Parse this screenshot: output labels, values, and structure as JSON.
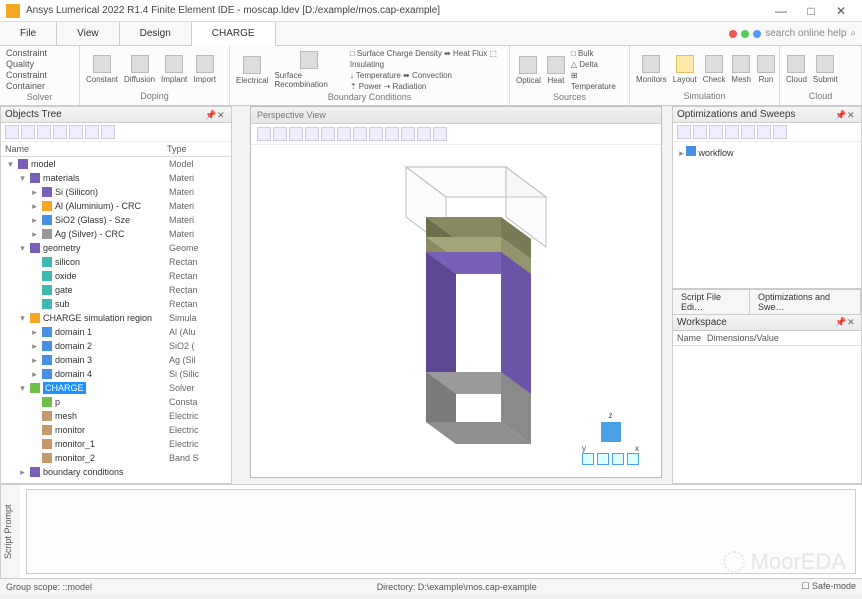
{
  "window": {
    "title": "Ansys Lumerical 2022 R1.4 Finite Element IDE - moscap.ldev [D:/example/mos.cap-example]",
    "min": "—",
    "max": "□",
    "close": "✕"
  },
  "menu": {
    "file": "File",
    "view": "View",
    "design": "Design",
    "charge": "CHARGE",
    "search_placeholder": "search online help",
    "search_sym": "⌕"
  },
  "ribbon": {
    "solver": {
      "label": "Solver",
      "constraint": "Constraint",
      "quality_constraint": "Quality Constraint",
      "container": "Container"
    },
    "doping": {
      "label": "Doping",
      "constant": "Constant",
      "diffusion": "Diffusion",
      "implant": "Implant",
      "import": "Import"
    },
    "boundary": {
      "label": "Boundary Conditions",
      "electrical": "Electrical",
      "surface_recomb": "Surface Recombination",
      "l1": "□ Surface Charge Density  ⬌ Heat Flux  ⬚ Insulating",
      "l2": "↓ Temperature            ⬌ Convection",
      "l3": "⇡ Power                  ⇢ Radiation"
    },
    "sources": {
      "label": "Sources",
      "optical": "Optical",
      "heat": "Heat",
      "bulk": "□ Bulk",
      "delta": "△ Delta",
      "temperature": "⊞ Temperature"
    },
    "simulation": {
      "label": "Simulation",
      "monitors": "Monitors",
      "layout": "Layout",
      "check": "Check",
      "mesh": "Mesh",
      "run": "Run"
    },
    "cloud": {
      "label": "Cloud",
      "cloud": "Cloud",
      "submit": "Submit"
    }
  },
  "objtree": {
    "title": "Objects Tree",
    "col1": "Name",
    "col2": "Type",
    "rows": [
      {
        "d": 0,
        "tw": "▾",
        "i": "purple",
        "n": "model",
        "t": "Model"
      },
      {
        "d": 1,
        "tw": "▾",
        "i": "purple",
        "n": "materials",
        "t": "Materi"
      },
      {
        "d": 2,
        "tw": "▸",
        "i": "purple",
        "n": "Si (Silicon)",
        "t": "Materi"
      },
      {
        "d": 2,
        "tw": "▸",
        "i": "orange",
        "n": "Al (Aluminium) - CRC",
        "t": "Materi"
      },
      {
        "d": 2,
        "tw": "▸",
        "i": "blue",
        "n": "SiO2 (Glass) - Sze",
        "t": "Materi"
      },
      {
        "d": 2,
        "tw": "▸",
        "i": "gray",
        "n": "Ag (Silver) - CRC",
        "t": "Materi"
      },
      {
        "d": 1,
        "tw": "▾",
        "i": "purple",
        "n": "geometry",
        "t": "Geome"
      },
      {
        "d": 2,
        "tw": "",
        "i": "teal",
        "n": "silicon",
        "t": "Rectan"
      },
      {
        "d": 2,
        "tw": "",
        "i": "teal",
        "n": "oxide",
        "t": "Rectan"
      },
      {
        "d": 2,
        "tw": "",
        "i": "teal",
        "n": "gate",
        "t": "Rectan"
      },
      {
        "d": 2,
        "tw": "",
        "i": "teal",
        "n": "sub",
        "t": "Rectan"
      },
      {
        "d": 1,
        "tw": "▾",
        "i": "orange",
        "n": "CHARGE simulation region",
        "t": "Simula"
      },
      {
        "d": 2,
        "tw": "▸",
        "i": "blue",
        "n": "domain 1",
        "t": "Al (Alu"
      },
      {
        "d": 2,
        "tw": "▸",
        "i": "blue",
        "n": "domain 2",
        "t": "SiO2 ("
      },
      {
        "d": 2,
        "tw": "▸",
        "i": "blue",
        "n": "domain 3",
        "t": "Ag (Sil"
      },
      {
        "d": 2,
        "tw": "▸",
        "i": "blue",
        "n": "domain 4",
        "t": "Si (Silic"
      },
      {
        "d": 1,
        "tw": "▾",
        "i": "green",
        "n": "CHARGE",
        "t": "Solver",
        "sel": true
      },
      {
        "d": 2,
        "tw": "",
        "i": "green",
        "n": "p",
        "t": "Consta"
      },
      {
        "d": 2,
        "tw": "",
        "i": "brown",
        "n": "mesh",
        "t": "Electric"
      },
      {
        "d": 2,
        "tw": "",
        "i": "brown",
        "n": "monitor",
        "t": "Electric"
      },
      {
        "d": 2,
        "tw": "",
        "i": "brown",
        "n": "monitor_1",
        "t": "Electric"
      },
      {
        "d": 2,
        "tw": "",
        "i": "brown",
        "n": "monitor_2",
        "t": "Band S"
      },
      {
        "d": 1,
        "tw": "▸",
        "i": "purple",
        "n": "boundary conditions",
        "t": ""
      }
    ]
  },
  "viewport": {
    "title": "Perspective View"
  },
  "opt": {
    "title": "Optimizations and Sweeps",
    "workflow": "workflow",
    "tab1": "Script File Edi…",
    "tab2": "Optimizations and Swe…"
  },
  "workspace": {
    "title": "Workspace",
    "col1": "Name",
    "col2": "Dimensions/Value"
  },
  "script_prompt": "Script Prompt",
  "status": {
    "left": "Group scope: ::model",
    "mid": "Directory: D:\\example\\mos.cap-example",
    "safe": "Safe-mode"
  },
  "watermark": "MoorEDA"
}
